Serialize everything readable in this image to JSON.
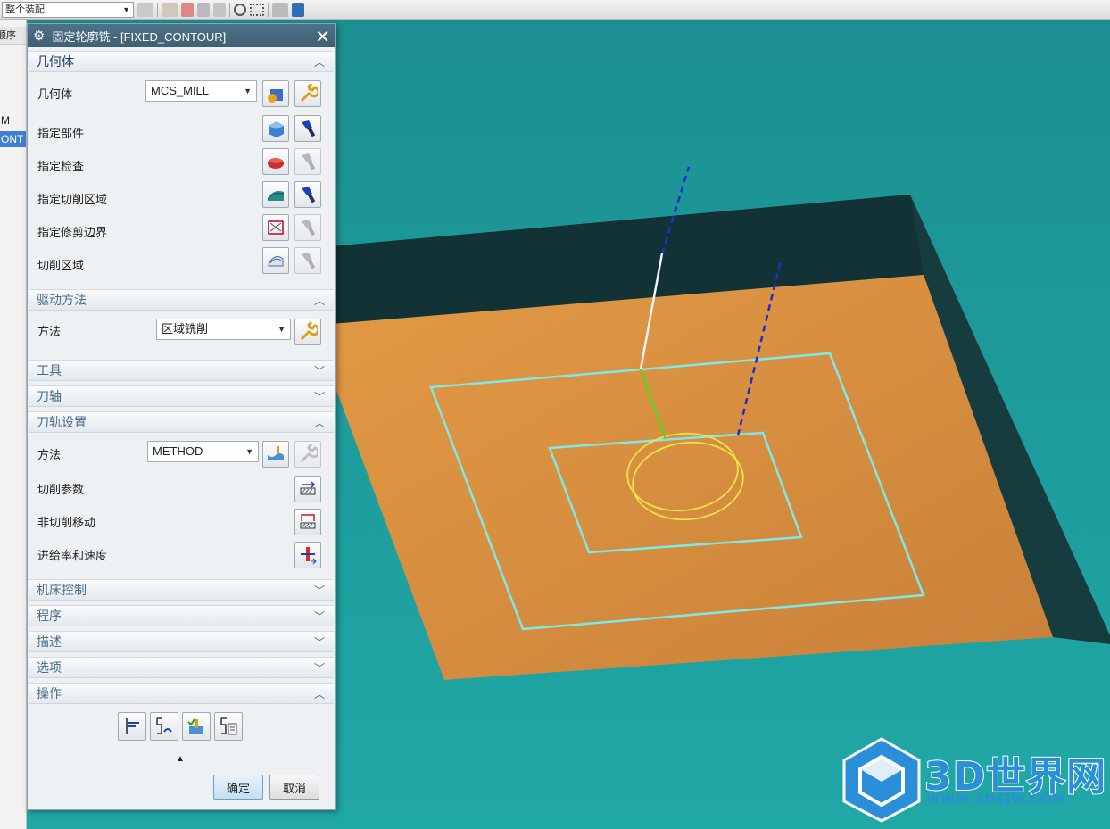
{
  "toolbar": {
    "assembly_filter": "整个装配"
  },
  "navigator": {
    "header": "顺序",
    "items": [
      {
        "label": "M",
        "selected": false
      },
      {
        "label": "ONT",
        "selected": true
      }
    ]
  },
  "dialog": {
    "title": "固定轮廓铣 - [FIXED_CONTOUR]",
    "sections": {
      "geometry": {
        "header": "几何体",
        "expanded": true,
        "geometry_label": "几何体",
        "geometry_value": "MCS_MILL",
        "specify_part": "指定部件",
        "specify_check": "指定检查",
        "specify_cut_area": "指定切削区域",
        "specify_trim_boundary": "指定修剪边界",
        "cut_region": "切削区域"
      },
      "drive_method": {
        "header": "驱动方法",
        "expanded": true,
        "method_label": "方法",
        "method_value": "区域铣削"
      },
      "tool": {
        "header": "工具",
        "expanded": false
      },
      "tool_axis": {
        "header": "刀轴",
        "expanded": false
      },
      "path_settings": {
        "header": "刀轨设置",
        "expanded": true,
        "method_label": "方法",
        "method_value": "METHOD",
        "cut_params": "切削参数",
        "non_cut_moves": "非切削移动",
        "feeds_speeds": "进给率和速度"
      },
      "machine_control": {
        "header": "机床控制",
        "expanded": false
      },
      "program": {
        "header": "程序",
        "expanded": false
      },
      "description": {
        "header": "描述",
        "expanded": false
      },
      "options": {
        "header": "选项",
        "expanded": false
      },
      "actions": {
        "header": "操作",
        "expanded": true
      }
    },
    "ok_label": "确定",
    "cancel_label": "取消"
  },
  "watermark": {
    "text": "3D世界网",
    "url": "WWW.3DSJW.COM"
  },
  "colors": {
    "background": "#1e9e9e",
    "plate": "#d9923f",
    "pocket_wall": "#16383c",
    "boundary": "#7fe8e8",
    "circle": "#f0e04a",
    "tool_axis": "#1a2fd0"
  }
}
